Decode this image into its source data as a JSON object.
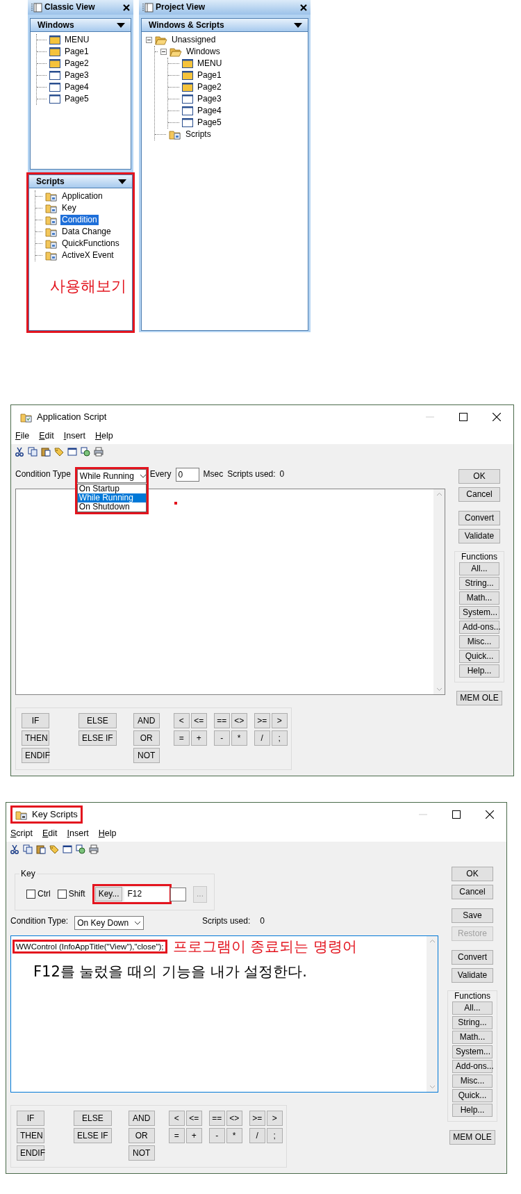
{
  "classic_view": {
    "title": "Classic View",
    "windows": {
      "title": "Windows",
      "items": [
        {
          "label": "MENU",
          "filled": true
        },
        {
          "label": "Page1",
          "filled": true
        },
        {
          "label": "Page2",
          "filled": true
        },
        {
          "label": "Page3",
          "filled": false
        },
        {
          "label": "Page4",
          "filled": false
        },
        {
          "label": "Page5",
          "filled": false
        }
      ]
    },
    "scripts": {
      "title": "Scripts",
      "highlighted": true,
      "note": "사용해보기",
      "items": [
        {
          "label": "Application",
          "selected": false
        },
        {
          "label": "Key",
          "selected": false
        },
        {
          "label": "Condition",
          "selected": true
        },
        {
          "label": "Data Change",
          "selected": false
        },
        {
          "label": "QuickFunctions",
          "selected": false
        },
        {
          "label": "ActiveX Event",
          "selected": false
        }
      ]
    }
  },
  "project_view": {
    "title": "Project View",
    "section": "Windows & Scripts",
    "tree": [
      {
        "label": "Unassigned",
        "kind": "folder",
        "expanded": true,
        "children": [
          {
            "label": "Windows",
            "kind": "folder",
            "expanded": true,
            "children": [
              {
                "label": "MENU",
                "kind": "window",
                "filled": true
              },
              {
                "label": "Page1",
                "kind": "window",
                "filled": true
              },
              {
                "label": "Page2",
                "kind": "window",
                "filled": true
              },
              {
                "label": "Page3",
                "kind": "window",
                "filled": false
              },
              {
                "label": "Page4",
                "kind": "window",
                "filled": false
              },
              {
                "label": "Page5",
                "kind": "window",
                "filled": false
              }
            ]
          },
          {
            "label": "Scripts",
            "kind": "scripts"
          }
        ]
      }
    ]
  },
  "application_script": {
    "title": "Application Script",
    "title_highlighted": false,
    "menu": [
      "File",
      "Edit",
      "Insert",
      "Help"
    ],
    "condition": {
      "label": "Condition Type",
      "value": "While Running",
      "highlighted": true,
      "options": [
        {
          "label": "On Startup",
          "selected": false
        },
        {
          "label": "While Running",
          "selected": true
        },
        {
          "label": "On Shutdown",
          "selected": false
        }
      ]
    },
    "interval": {
      "label": "Every",
      "value": "0",
      "unit": "Msec"
    },
    "scripts_used": {
      "label": "Scripts used:",
      "value": "0"
    },
    "editor": {
      "focused": false,
      "marker": true
    },
    "buttons": [
      {
        "label": "OK",
        "disabled": false
      },
      {
        "label": "Cancel",
        "disabled": false
      },
      {
        "label": "Convert",
        "disabled": false
      },
      {
        "label": "Validate",
        "disabled": false
      }
    ],
    "functions": {
      "title": "Functions",
      "buttons": [
        "All...",
        "String...",
        "Math...",
        "System...",
        "Add-ons...",
        "Misc...",
        "Quick...",
        "Help..."
      ]
    },
    "extra_button": "MEM OLE",
    "keypad": {
      "keywords": [
        [
          "IF",
          "THEN",
          "ENDIF"
        ],
        [
          "ELSE",
          "ELSE IF"
        ],
        [
          "AND",
          "OR",
          "NOT"
        ]
      ],
      "operators": [
        [
          [
            "<",
            "<="
          ],
          [
            "==",
            "<>"
          ],
          [
            ">=",
            ">"
          ]
        ],
        [
          [
            "=",
            "+"
          ],
          [
            "-",
            "*"
          ],
          [
            "/",
            ";"
          ]
        ]
      ]
    }
  },
  "key_scripts": {
    "title": "Key Scripts",
    "title_highlighted": true,
    "menu": [
      "Script",
      "Edit",
      "Insert",
      "Help"
    ],
    "key_group": {
      "title": "Key",
      "modifiers": [
        {
          "label": "Ctrl",
          "checked": false
        },
        {
          "label": "Shift",
          "checked": false
        }
      ],
      "key_button": "Key...",
      "key_value": "F12",
      "highlighted": true,
      "browse_button": {
        "label": "...",
        "disabled": true
      }
    },
    "condition": {
      "label": "Condition Type:",
      "value": "On Key Down",
      "highlighted": false
    },
    "scripts_used": {
      "label": "Scripts used:",
      "value": "0"
    },
    "editor": {
      "focused": true,
      "code": "WWControl (InfoAppTitle(\"View\"),\"close\");",
      "code_highlighted": true,
      "note": "프로그램이 종료되는 명령어",
      "explanation": "F12를 눌렀을 때의 기능을 내가 설정한다."
    },
    "buttons": [
      {
        "label": "OK",
        "disabled": false
      },
      {
        "label": "Cancel",
        "disabled": false
      },
      {
        "label": "Save",
        "disabled": false
      },
      {
        "label": "Restore",
        "disabled": true
      },
      {
        "label": "Convert",
        "disabled": false
      },
      {
        "label": "Validate",
        "disabled": false
      }
    ],
    "functions": {
      "title": "Functions",
      "buttons": [
        "All...",
        "String...",
        "Math...",
        "System...",
        "Add-ons...",
        "Misc...",
        "Quick...",
        "Help..."
      ]
    },
    "extra_button": "MEM OLE",
    "keypad": {
      "keywords": [
        [
          "IF",
          "THEN",
          "ENDIF"
        ],
        [
          "ELSE",
          "ELSE IF"
        ],
        [
          "AND",
          "OR",
          "NOT"
        ]
      ],
      "operators": [
        [
          [
            "<",
            "<="
          ],
          [
            "==",
            "<>"
          ],
          [
            ">=",
            ">"
          ]
        ],
        [
          [
            "=",
            "+"
          ],
          [
            "-",
            "*"
          ],
          [
            "/",
            ";"
          ]
        ]
      ]
    }
  }
}
